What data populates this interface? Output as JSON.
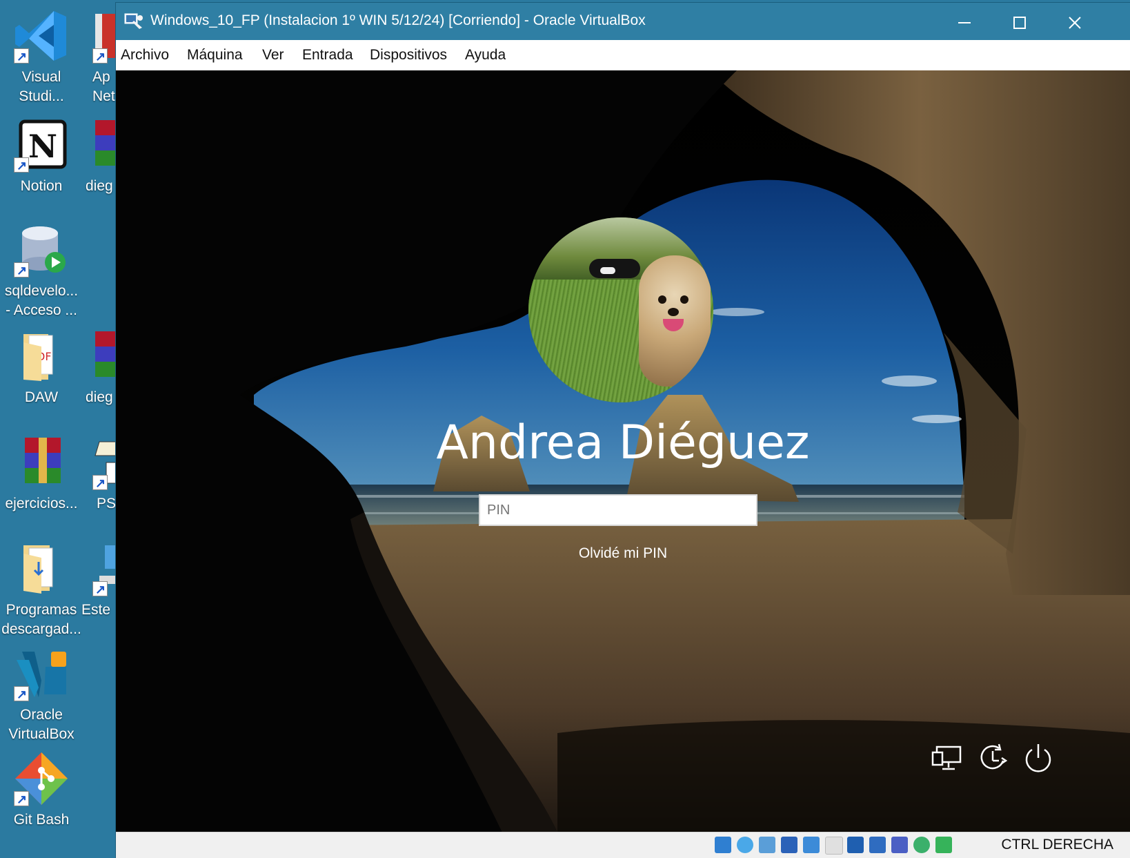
{
  "desktop": {
    "icons": [
      {
        "label_lines": [
          "Visual",
          "Studi..."
        ]
      },
      {
        "label_lines": [
          "Ap",
          "Net"
        ]
      },
      {
        "label_lines": [
          "Notion"
        ]
      },
      {
        "label_lines": [
          "dieg"
        ]
      },
      {
        "label_lines": [
          "sqldevelo...",
          "- Acceso ..."
        ]
      },
      {
        "label_lines": [
          "DAW"
        ]
      },
      {
        "label_lines": [
          "dieg"
        ]
      },
      {
        "label_lines": [
          "ejercicios..."
        ]
      },
      {
        "label_lines": [
          "PS"
        ]
      },
      {
        "label_lines": [
          "Programas",
          "descargad..."
        ]
      },
      {
        "label_lines": [
          "Este"
        ]
      },
      {
        "label_lines": [
          "Oracle",
          "VirtualBox"
        ]
      },
      {
        "label_lines": [
          "Git Bash"
        ]
      }
    ]
  },
  "window": {
    "title": "Windows_10_FP (Instalacion 1º WIN 5/12/24) [Corriendo] - Oracle VirtualBox",
    "controls": {
      "minimize": "—",
      "maximize": "☐",
      "close": "✕"
    },
    "menu": [
      "Archivo",
      "Máquina",
      "Ver",
      "Entrada",
      "Dispositivos",
      "Ayuda"
    ]
  },
  "login": {
    "username": "Andrea Diéguez",
    "pin_placeholder": "PIN",
    "forgot_pin": "Olvidé mi PIN",
    "system_buttons": [
      "network-icon",
      "accessibility-icon",
      "power-icon"
    ]
  },
  "statusbar": {
    "icons": [
      "hard-disk-icon",
      "optical-drive-icon",
      "audio-icon",
      "network-adapters-icon",
      "usb-icon",
      "shared-folders-icon",
      "display-icon",
      "recording-icon",
      "cpu-icon",
      "mouse-integration-icon",
      "keyboard-capture-icon"
    ],
    "host_key": "CTRL DERECHA"
  },
  "colors": {
    "titlebar": "#2f7fa4",
    "desktop": "#2b7aa0",
    "menubar": "#ffffff"
  }
}
